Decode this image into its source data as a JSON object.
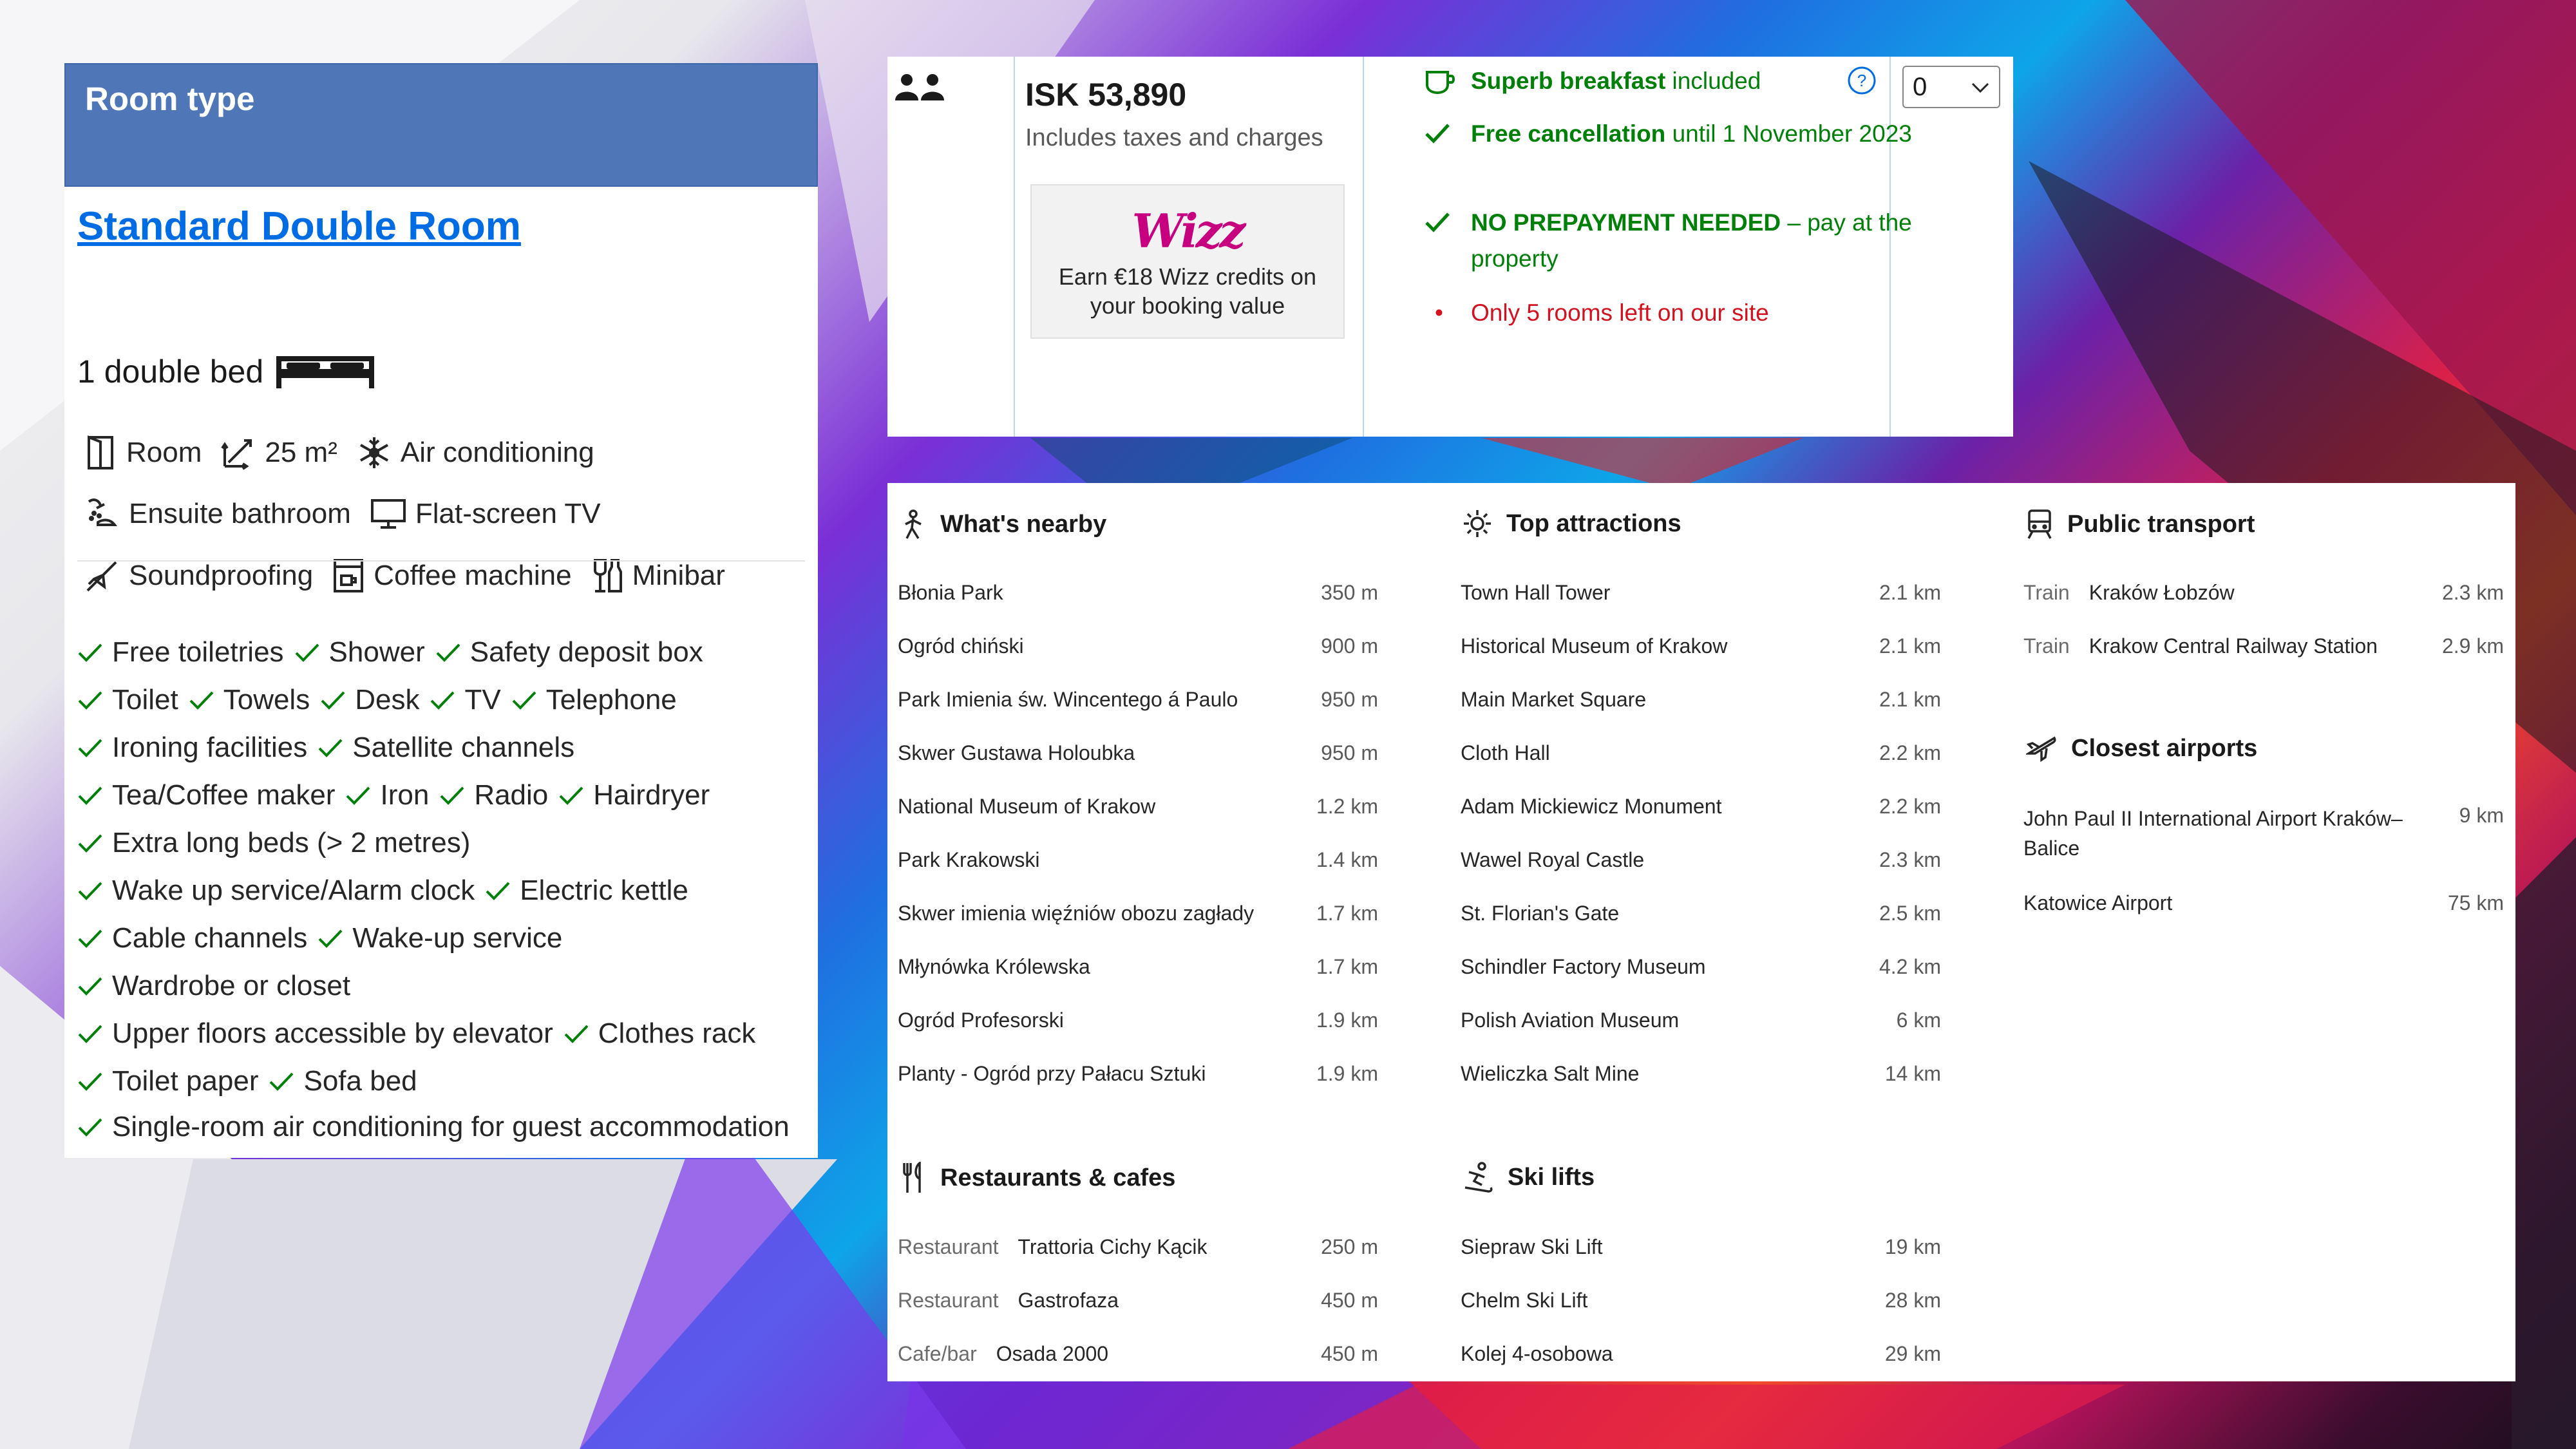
{
  "room": {
    "header": "Room type",
    "name": "Standard Double Room",
    "bed": "1 double bed",
    "facilities": [
      [
        "Room",
        "25 m²",
        "Air conditioning"
      ],
      [
        "Ensuite bathroom",
        "Flat-screen TV"
      ],
      [
        "Soundproofing",
        "Coffee machine",
        "Minibar"
      ]
    ],
    "facility_icons": [
      [
        "door-icon",
        "size-icon",
        "snowflake-icon"
      ],
      [
        "bath-icon",
        "monitor-icon"
      ],
      [
        "soundproof-icon",
        "coffee-machine-icon",
        "minibar-icon"
      ]
    ],
    "amenities": [
      [
        "Free toiletries",
        "Shower",
        "Safety deposit box"
      ],
      [
        "Toilet",
        "Towels",
        "Desk",
        "TV",
        "Telephone"
      ],
      [
        "Ironing facilities",
        "Satellite channels"
      ],
      [
        "Tea/Coffee maker",
        "Iron",
        "Radio",
        "Hairdryer"
      ],
      [
        "Extra long beds (> 2 metres)"
      ],
      [
        "Wake up service/Alarm clock",
        "Electric kettle"
      ],
      [
        "Cable channels",
        "Wake-up service"
      ],
      [
        "Wardrobe or closet"
      ],
      [
        "Upper floors accessible by elevator",
        "Clothes rack"
      ],
      [
        "Toilet paper",
        "Sofa bed"
      ],
      [
        "Single-room air conditioning for guest accommodation"
      ]
    ]
  },
  "pricing": {
    "occupancy_icon": "two-persons-icon",
    "price": "ISK 53,890",
    "price_note": "Includes taxes and charges",
    "partner_logo": "Wizz",
    "partner_text": "Earn €18 Wizz credits on your booking value",
    "breakfast_bold": "Superb breakfast",
    "breakfast_rest": " included",
    "cancel_bold": "Free cancellation",
    "cancel_rest": " until 1 November 2023",
    "prepay_bold": "NO PREPAYMENT NEEDED",
    "prepay_rest": " – pay at the property",
    "rooms_left": "Only 5 rooms left on our site",
    "quantity": "0"
  },
  "surroundings": {
    "nearby": {
      "title": "What's nearby",
      "items": [
        {
          "name": "Błonia Park",
          "dist": "350 m"
        },
        {
          "name": "Ogród chiński",
          "dist": "900 m"
        },
        {
          "name": "Park Imienia św. Wincentego á Paulo",
          "dist": "950 m"
        },
        {
          "name": "Skwer Gustawa Holoubka",
          "dist": "950 m"
        },
        {
          "name": "National Museum of Krakow",
          "dist": "1.2 km"
        },
        {
          "name": "Park Krakowski",
          "dist": "1.4 km"
        },
        {
          "name": "Skwer imienia więźniów obozu zagłady",
          "dist": "1.7 km"
        },
        {
          "name": "Młynówka Królewska",
          "dist": "1.7 km"
        },
        {
          "name": "Ogród Profesorski",
          "dist": "1.9 km"
        },
        {
          "name": "Planty - Ogród przy Pałacu Sztuki",
          "dist": "1.9 km"
        }
      ]
    },
    "attractions": {
      "title": "Top attractions",
      "items": [
        {
          "name": "Town Hall Tower",
          "dist": "2.1 km"
        },
        {
          "name": "Historical Museum of Krakow",
          "dist": "2.1 km"
        },
        {
          "name": "Main Market Square",
          "dist": "2.1 km"
        },
        {
          "name": "Cloth Hall",
          "dist": "2.2 km"
        },
        {
          "name": "Adam Mickiewicz Monument",
          "dist": "2.2 km"
        },
        {
          "name": "Wawel Royal Castle",
          "dist": "2.3 km"
        },
        {
          "name": "St. Florian's Gate",
          "dist": "2.5 km"
        },
        {
          "name": "Schindler Factory Museum",
          "dist": "4.2 km"
        },
        {
          "name": "Polish Aviation Museum",
          "dist": "6 km"
        },
        {
          "name": "Wieliczka Salt Mine",
          "dist": "14 km"
        }
      ]
    },
    "transport": {
      "title": "Public transport",
      "items": [
        {
          "kind": "Train",
          "name": "Kraków Łobzów",
          "dist": "2.3 km"
        },
        {
          "kind": "Train",
          "name": "Krakow Central Railway Station",
          "dist": "2.9 km"
        }
      ]
    },
    "airports": {
      "title": "Closest airports",
      "items": [
        {
          "name": "John Paul II International Airport Kraków–Balice",
          "dist": "9 km"
        },
        {
          "name": "Katowice Airport",
          "dist": "75 km"
        }
      ]
    },
    "restaurants": {
      "title": "Restaurants & cafes",
      "items": [
        {
          "kind": "Restaurant",
          "name": "Trattoria Cichy Kącik",
          "dist": "250 m"
        },
        {
          "kind": "Restaurant",
          "name": "Gastrofaza",
          "dist": "450 m"
        },
        {
          "kind": "Cafe/bar",
          "name": "Osada 2000",
          "dist": "450 m"
        }
      ]
    },
    "ski": {
      "title": "Ski lifts",
      "items": [
        {
          "name": "Siepraw Ski Lift",
          "dist": "19 km"
        },
        {
          "name": "Chelm Ski Lift",
          "dist": "28 km"
        },
        {
          "name": "Kolej 4-osobowa",
          "dist": "29 km"
        }
      ]
    }
  },
  "colors": {
    "header_blue": "#4f77b8",
    "link_blue": "#006ce4",
    "positive_green": "#008009",
    "urgent_red": "#d4111e"
  }
}
